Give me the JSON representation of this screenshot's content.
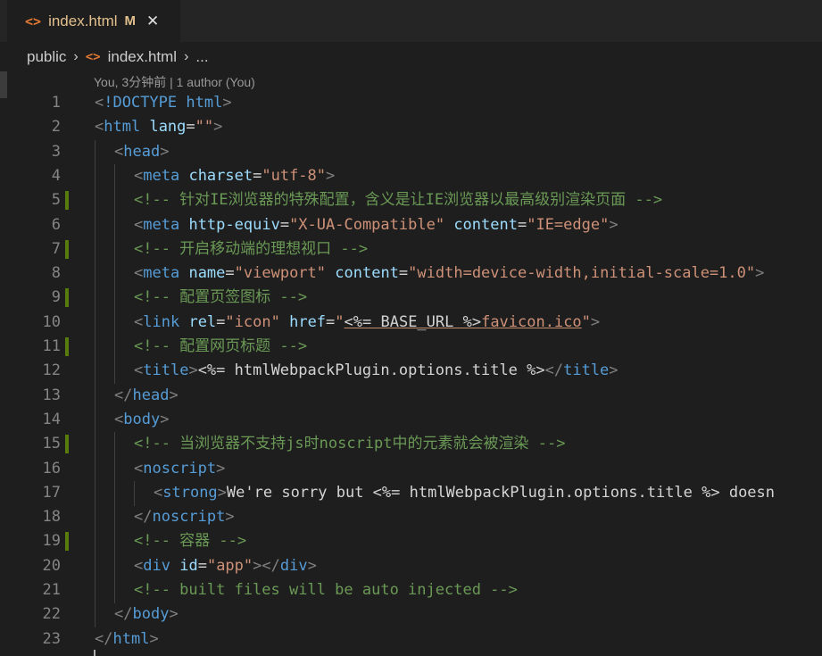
{
  "tab": {
    "icon": "<>",
    "filename": "index.html",
    "modified": "M",
    "close": "✕"
  },
  "breadcrumb": {
    "folder": "public",
    "file_icon": "<>",
    "file": "index.html",
    "more": "..."
  },
  "codelens": "You, 3分钟前 | 1 author (You)",
  "lines": [
    {
      "n": "1",
      "indent": 0,
      "tokens": [
        [
          "p",
          "<"
        ],
        [
          "t",
          "!DOCTYPE "
        ],
        [
          "t",
          "html"
        ],
        [
          "p",
          ">"
        ]
      ]
    },
    {
      "n": "2",
      "indent": 0,
      "tokens": [
        [
          "p",
          "<"
        ],
        [
          "t",
          "html"
        ],
        [
          "x",
          " "
        ],
        [
          "a",
          "lang"
        ],
        [
          "x",
          "="
        ],
        [
          "s",
          "\"\""
        ],
        [
          "p",
          ">"
        ]
      ]
    },
    {
      "n": "3",
      "indent": 1,
      "tokens": [
        [
          "p",
          "<"
        ],
        [
          "t",
          "head"
        ],
        [
          "p",
          ">"
        ]
      ]
    },
    {
      "n": "4",
      "indent": 2,
      "tokens": [
        [
          "p",
          "<"
        ],
        [
          "t",
          "meta"
        ],
        [
          "x",
          " "
        ],
        [
          "a",
          "charset"
        ],
        [
          "x",
          "="
        ],
        [
          "s",
          "\"utf-8\""
        ],
        [
          "p",
          ">"
        ]
      ]
    },
    {
      "n": "5",
      "indent": 2,
      "git": true,
      "tokens": [
        [
          "c",
          "<!-- 针对IE浏览器的特殊配置，含义是让IE浏览器以最高级别渲染页面 -->"
        ]
      ]
    },
    {
      "n": "6",
      "indent": 2,
      "tokens": [
        [
          "p",
          "<"
        ],
        [
          "t",
          "meta"
        ],
        [
          "x",
          " "
        ],
        [
          "a",
          "http-equiv"
        ],
        [
          "x",
          "="
        ],
        [
          "s",
          "\"X-UA-Compatible\""
        ],
        [
          "x",
          " "
        ],
        [
          "a",
          "content"
        ],
        [
          "x",
          "="
        ],
        [
          "s",
          "\"IE=edge\""
        ],
        [
          "p",
          ">"
        ]
      ]
    },
    {
      "n": "7",
      "indent": 2,
      "git": true,
      "tokens": [
        [
          "c",
          "<!-- 开启移动端的理想视口 -->"
        ]
      ]
    },
    {
      "n": "8",
      "indent": 2,
      "tokens": [
        [
          "p",
          "<"
        ],
        [
          "t",
          "meta"
        ],
        [
          "x",
          " "
        ],
        [
          "a",
          "name"
        ],
        [
          "x",
          "="
        ],
        [
          "s",
          "\"viewport\""
        ],
        [
          "x",
          " "
        ],
        [
          "a",
          "content"
        ],
        [
          "x",
          "="
        ],
        [
          "s",
          "\"width=device-width,initial-scale=1.0\""
        ],
        [
          "p",
          ">"
        ]
      ]
    },
    {
      "n": "9",
      "indent": 2,
      "git": true,
      "tokens": [
        [
          "c",
          "<!-- 配置页签图标 -->"
        ]
      ]
    },
    {
      "n": "10",
      "indent": 2,
      "tokens": [
        [
          "p",
          "<"
        ],
        [
          "t",
          "link"
        ],
        [
          "x",
          " "
        ],
        [
          "a",
          "rel"
        ],
        [
          "x",
          "="
        ],
        [
          "s",
          "\"icon\""
        ],
        [
          "x",
          " "
        ],
        [
          "a",
          "href"
        ],
        [
          "x",
          "="
        ],
        [
          "s",
          "\""
        ],
        [
          "xu",
          "<%= BASE_URL %>"
        ],
        [
          "su",
          "favicon.ico"
        ],
        [
          "s",
          "\""
        ],
        [
          "p",
          ">"
        ]
      ]
    },
    {
      "n": "11",
      "indent": 2,
      "git": true,
      "tokens": [
        [
          "c",
          "<!-- 配置网页标题 -->"
        ]
      ]
    },
    {
      "n": "12",
      "indent": 2,
      "tokens": [
        [
          "p",
          "<"
        ],
        [
          "t",
          "title"
        ],
        [
          "p",
          ">"
        ],
        [
          "x",
          "<%= htmlWebpackPlugin.options.title %>"
        ],
        [
          "p",
          "</"
        ],
        [
          "t",
          "title"
        ],
        [
          "p",
          ">"
        ]
      ]
    },
    {
      "n": "13",
      "indent": 1,
      "tokens": [
        [
          "p",
          "</"
        ],
        [
          "t",
          "head"
        ],
        [
          "p",
          ">"
        ]
      ]
    },
    {
      "n": "14",
      "indent": 1,
      "tokens": [
        [
          "p",
          "<"
        ],
        [
          "t",
          "body"
        ],
        [
          "p",
          ">"
        ]
      ]
    },
    {
      "n": "15",
      "indent": 2,
      "git": true,
      "tokens": [
        [
          "c",
          "<!-- 当浏览器不支持js时noscript中的元素就会被渲染 -->"
        ]
      ]
    },
    {
      "n": "16",
      "indent": 2,
      "tokens": [
        [
          "p",
          "<"
        ],
        [
          "t",
          "noscript"
        ],
        [
          "p",
          ">"
        ]
      ]
    },
    {
      "n": "17",
      "indent": 3,
      "tokens": [
        [
          "p",
          "<"
        ],
        [
          "t",
          "strong"
        ],
        [
          "p",
          ">"
        ],
        [
          "x",
          "We're sorry but <%= htmlWebpackPlugin.options.title %> doesn"
        ]
      ]
    },
    {
      "n": "18",
      "indent": 2,
      "tokens": [
        [
          "p",
          "</"
        ],
        [
          "t",
          "noscript"
        ],
        [
          "p",
          ">"
        ]
      ]
    },
    {
      "n": "19",
      "indent": 2,
      "git": true,
      "tokens": [
        [
          "c",
          "<!-- 容器 -->"
        ]
      ]
    },
    {
      "n": "20",
      "indent": 2,
      "tokens": [
        [
          "p",
          "<"
        ],
        [
          "t",
          "div"
        ],
        [
          "x",
          " "
        ],
        [
          "a",
          "id"
        ],
        [
          "x",
          "="
        ],
        [
          "s",
          "\"app\""
        ],
        [
          "p",
          "></"
        ],
        [
          "t",
          "div"
        ],
        [
          "p",
          ">"
        ]
      ]
    },
    {
      "n": "21",
      "indent": 2,
      "tokens": [
        [
          "c",
          "<!-- built files will be auto injected -->"
        ]
      ]
    },
    {
      "n": "22",
      "indent": 1,
      "tokens": [
        [
          "p",
          "</"
        ],
        [
          "t",
          "body"
        ],
        [
          "p",
          ">"
        ]
      ]
    },
    {
      "n": "23",
      "indent": 0,
      "tokens": [
        [
          "p",
          "</"
        ],
        [
          "t",
          "html"
        ],
        [
          "p",
          ">"
        ]
      ]
    }
  ]
}
